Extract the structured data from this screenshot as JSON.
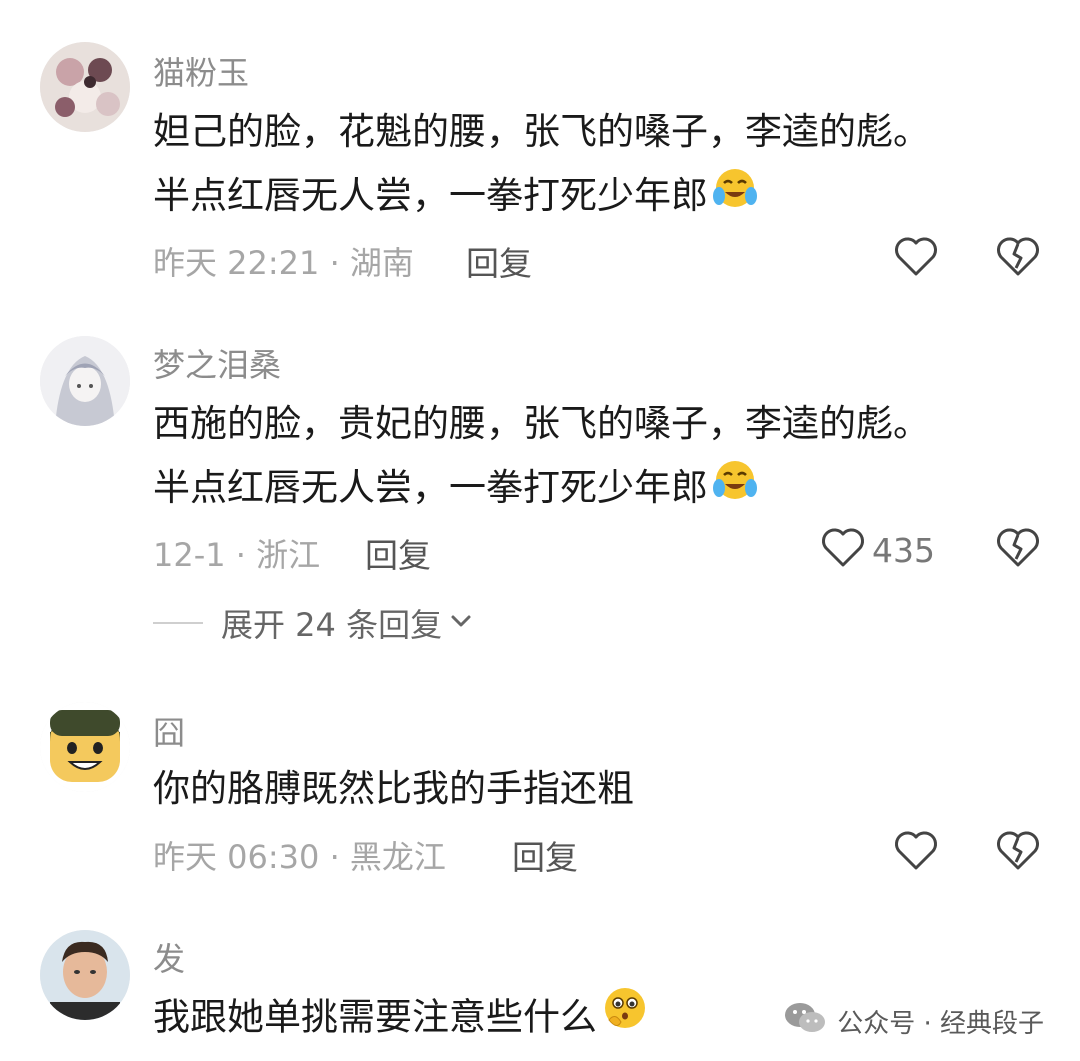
{
  "comments": [
    {
      "username": "猫粉玉",
      "line1": "妲己的脸，花魁的腰，张飞的嗓子，李逵的彪。",
      "line2": "半点红唇无人尝，一拳打死少年郎",
      "meta": "昨天 22:21 · 湖南",
      "reply": "回复",
      "likes": ""
    },
    {
      "username": "梦之泪桑",
      "line1": "西施的脸，贵妃的腰，张飞的嗓子，李逵的彪。",
      "line2": "半点红唇无人尝，一拳打死少年郎",
      "meta": "12-1 · 浙江",
      "reply": "回复",
      "likes": "435"
    },
    {
      "username": "囧",
      "line1": "你的胳膊既然比我的手指还粗",
      "meta": "昨天 06:30 · 黑龙江",
      "reply": "回复",
      "likes": ""
    },
    {
      "username": "发",
      "line1": "我跟她单挑需要注意些什么"
    }
  ],
  "expand_replies": "展开 24 条回复",
  "watermark": "公众号 · 经典段子",
  "icons": {
    "like": "heart-outline-icon",
    "dislike": "broken-heart-icon",
    "emoji_cry": "crying-laughing-emoji-icon",
    "emoji_think": "thinking-emoji-icon",
    "wechat": "wechat-logo-icon"
  },
  "colors": {
    "text": "#1a1a1a",
    "username": "#8c8c8c",
    "meta": "#a6a6a6"
  }
}
